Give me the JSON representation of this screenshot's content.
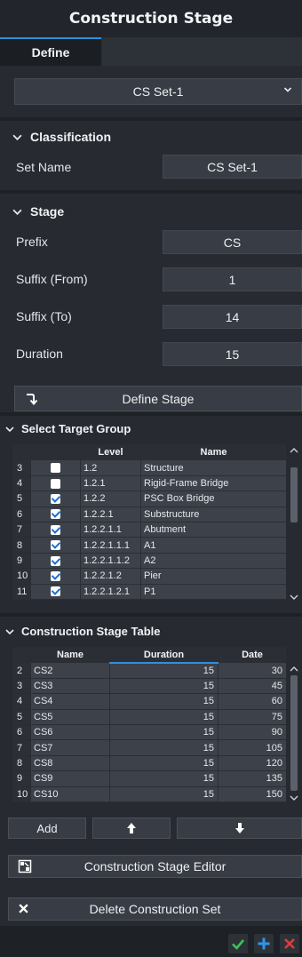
{
  "window": {
    "title": "Construction Stage"
  },
  "tabs": [
    {
      "label": "Define"
    }
  ],
  "cs_set": {
    "selected": "CS Set-1"
  },
  "classification": {
    "heading": "Classification",
    "set_name_label": "Set Name",
    "set_name_value": "CS Set-1"
  },
  "stage": {
    "heading": "Stage",
    "prefix_label": "Prefix",
    "prefix_value": "CS",
    "suffix_from_label": "Suffix (From)",
    "suffix_from_value": "1",
    "suffix_to_label": "Suffix (To)",
    "suffix_to_value": "14",
    "duration_label": "Duration",
    "duration_value": "15",
    "define_button": "Define Stage"
  },
  "target_group": {
    "heading": "Select Target Group",
    "columns": [
      "",
      "",
      "Level",
      "Name"
    ],
    "rows": [
      {
        "n": "3",
        "checked": false,
        "level": "1.2",
        "name": "Structure"
      },
      {
        "n": "4",
        "checked": false,
        "level": "1.2.1",
        "name": "Rigid-Frame Bridge"
      },
      {
        "n": "5",
        "checked": true,
        "level": "1.2.2",
        "name": "PSC Box Bridge"
      },
      {
        "n": "6",
        "checked": true,
        "level": "1.2.2.1",
        "name": "Substructure"
      },
      {
        "n": "7",
        "checked": true,
        "level": "1.2.2.1.1",
        "name": "Abutment"
      },
      {
        "n": "8",
        "checked": true,
        "level": "1.2.2.1.1.1",
        "name": "A1"
      },
      {
        "n": "9",
        "checked": true,
        "level": "1.2.2.1.1.2",
        "name": "A2"
      },
      {
        "n": "10",
        "checked": true,
        "level": "1.2.2.1.2",
        "name": "Pier"
      },
      {
        "n": "11",
        "checked": true,
        "level": "1.2.2.1.2.1",
        "name": "P1"
      }
    ]
  },
  "stage_table": {
    "heading": "Construction Stage Table",
    "columns": [
      "",
      "Name",
      "Duration",
      "Date"
    ],
    "rows": [
      {
        "n": "2",
        "name": "CS2",
        "duration": "15",
        "date": "30"
      },
      {
        "n": "3",
        "name": "CS3",
        "duration": "15",
        "date": "45"
      },
      {
        "n": "4",
        "name": "CS4",
        "duration": "15",
        "date": "60"
      },
      {
        "n": "5",
        "name": "CS5",
        "duration": "15",
        "date": "75"
      },
      {
        "n": "6",
        "name": "CS6",
        "duration": "15",
        "date": "90"
      },
      {
        "n": "7",
        "name": "CS7",
        "duration": "15",
        "date": "105"
      },
      {
        "n": "8",
        "name": "CS8",
        "duration": "15",
        "date": "120"
      },
      {
        "n": "9",
        "name": "CS9",
        "duration": "15",
        "date": "135"
      },
      {
        "n": "10",
        "name": "CS10",
        "duration": "15",
        "date": "150"
      }
    ],
    "add_button": "Add",
    "editor_button": "Construction Stage Editor",
    "delete_button": "Delete Construction Set"
  },
  "colors": {
    "accent": "#2f8fe0",
    "ok": "#3cc45a",
    "add": "#2f95ea",
    "cancel": "#e23b3b"
  },
  "icons": [
    "chevron-down-icon",
    "arrow-turn-down-icon",
    "arrow-up-icon",
    "arrow-down-icon",
    "grid-edit-icon",
    "close-icon",
    "check-icon",
    "plus-icon"
  ]
}
